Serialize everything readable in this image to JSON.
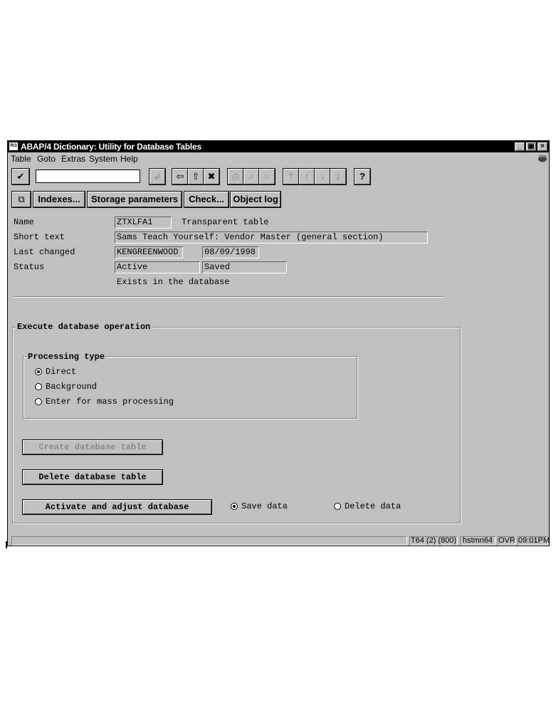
{
  "window": {
    "title": "ABAP/4 Dictionary: Utility for Database Tables",
    "sys_icon_text": "R/3",
    "buttons": {
      "minimize": "_",
      "restore": "▣",
      "close": "×"
    }
  },
  "menu": [
    {
      "label": "Table"
    },
    {
      "label": "Goto"
    },
    {
      "label": "Extras"
    },
    {
      "label": "System"
    },
    {
      "label": "Help"
    }
  ],
  "toolbar": {
    "command_field_value": "",
    "icons": {
      "check": "✔",
      "enter": "↲",
      "back": "⇦",
      "exit": "⇧",
      "cancel": "✖",
      "print": "⎙",
      "find": "⌕",
      "find_next": "⌕",
      "first_page": "⤒",
      "prev_page": "↑",
      "next_page": "↓",
      "last_page": "⤓",
      "help": "?"
    }
  },
  "app_toolbar": {
    "other_icon": "⧉",
    "indexes": "Indexes...",
    "storage": "Storage parameters",
    "check": "Check...",
    "object_log": "Object log"
  },
  "header": {
    "name_label": "Name",
    "name_value": "ZTXLFA1",
    "table_type": "Transparent table",
    "short_text_label": "Short text",
    "short_text_value": "Sams Teach Yourself: Vendor Master (general section)",
    "last_changed_label": "Last changed",
    "changed_by": "KENGREENWOOD",
    "changed_date": "08/09/1998",
    "status_label": "Status",
    "status_value": "Active",
    "status_saved": "Saved",
    "exists_text": "Exists in the database"
  },
  "execute": {
    "frame_title": "Execute database operation",
    "processing": {
      "frame_title": "Processing type",
      "options": [
        {
          "label": "Direct",
          "selected": true
        },
        {
          "label": "Background",
          "selected": false
        },
        {
          "label": "Enter for mass processing",
          "selected": false
        }
      ]
    },
    "create_button": "Create database table",
    "delete_button": "Delete database table",
    "activate_button": "Activate and adjust database",
    "save_data": {
      "label": "Save data",
      "selected": true
    },
    "delete_data": {
      "label": "Delete data",
      "selected": false
    }
  },
  "statusbar": {
    "message": "",
    "system": "T64 (2) (800)",
    "server": "hstmn64",
    "mode": "OVR",
    "time": "09:01PM"
  }
}
